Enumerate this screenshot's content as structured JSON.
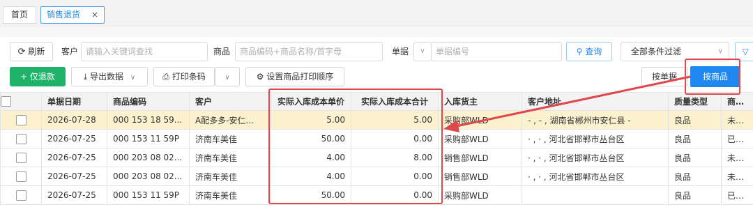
{
  "tabs": [
    {
      "label": "首页"
    },
    {
      "label": "销售退货",
      "close": "×"
    }
  ],
  "toolbar": {
    "refresh_label": "刷新",
    "customer_label": "客户",
    "customer_placeholder": "请输入关键词查找",
    "product_label": "商品",
    "product_placeholder": "商品编码+商品名称/首字母",
    "doc_label": "单据",
    "doc_placeholder": "单据编号",
    "query_label": "查询",
    "filter_value": "全部条件过滤",
    "add_return_label": "+ 仅退款",
    "export_label": "导出数据",
    "print_barcode_label": "打印条码",
    "print_order_label": "设置商品打印顺序",
    "by_doc_label": "按单据",
    "by_product_label": "按商品"
  },
  "table": {
    "headers": [
      "单据日期",
      "商品编码",
      "客户",
      "实际入库成本单价",
      "实际入库成本合计",
      "入库货主",
      "客户地址",
      "质量类型",
      "商品状"
    ],
    "rows": [
      [
        "2026-07-28",
        "000 153 18 59...",
        "A配多多-安仁...",
        "5.00",
        "5.00",
        "采购部WLD",
        "- , - , 湖南省郴州市安仁县 -",
        "良品",
        "未关闭"
      ],
      [
        "2026-07-25",
        "000 153 11 59P",
        "济南车美佳",
        "50.00",
        "0.00",
        "采购部WLD",
        "· , · , 河北省邯郸市丛台区",
        "良品",
        "已关闭"
      ],
      [
        "2026-07-25",
        "000 203 08 02...",
        "济南车美佳",
        "4.00",
        "8.00",
        "销售部WLD",
        "· , · , 河北省邯郸市丛台区",
        "良品",
        "未关闭"
      ],
      [
        "2026-07-25",
        "000 203 08 02...",
        "济南车美佳",
        "4.00",
        "0.00",
        "销售部WLD",
        "· , · , 河北省邯郸市丛台区",
        "良品",
        "未关闭"
      ],
      [
        "2026-07-25",
        "000 153 11 59P",
        "济南车美佳",
        "50.00",
        "0.00",
        "采购部WLD",
        "",
        "良品",
        "已关闭"
      ]
    ]
  },
  "colors": {
    "accent": "#1e88f0",
    "green": "#1fb36a",
    "annotation": "#e0474c",
    "selected_row": "#fbf1cf"
  }
}
